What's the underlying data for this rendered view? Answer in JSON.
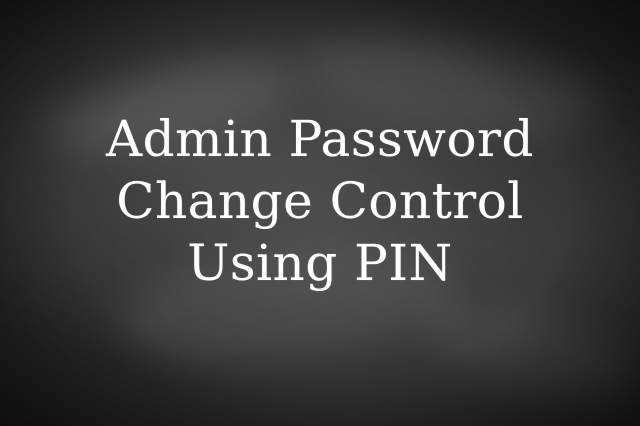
{
  "title": {
    "lines": [
      "Admin Password",
      "Change Control",
      "Using PIN"
    ]
  },
  "colors": {
    "background": "#2d2d2d",
    "text": "#ffffff"
  }
}
